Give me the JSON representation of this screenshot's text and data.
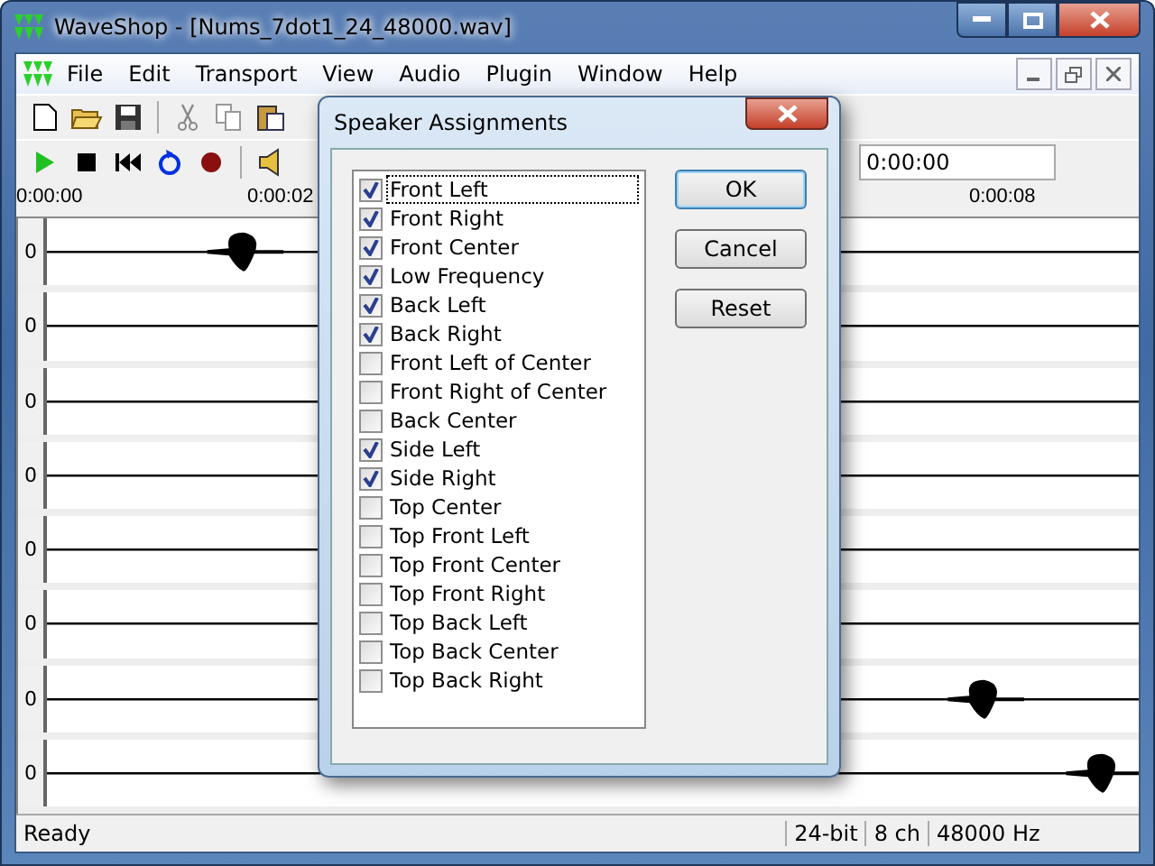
{
  "window": {
    "title": "WaveShop - [Nums_7dot1_24_48000.wav]"
  },
  "menu": [
    "File",
    "Edit",
    "Transport",
    "View",
    "Audio",
    "Plugin",
    "Window",
    "Help"
  ],
  "toolbar": {
    "position": "0:00:00"
  },
  "ruler": [
    "0:00:00",
    "0:00:02",
    "0:00:08"
  ],
  "tracks": [
    {
      "label": "0"
    },
    {
      "label": "0"
    },
    {
      "label": "0"
    },
    {
      "label": "0"
    },
    {
      "label": "0"
    },
    {
      "label": "0"
    },
    {
      "label": "0"
    },
    {
      "label": "0"
    }
  ],
  "dialog": {
    "title": "Speaker Assignments",
    "speakers": [
      {
        "label": "Front Left",
        "checked": true,
        "selected": true
      },
      {
        "label": "Front Right",
        "checked": true,
        "selected": false
      },
      {
        "label": "Front Center",
        "checked": true,
        "selected": false
      },
      {
        "label": "Low Frequency",
        "checked": true,
        "selected": false
      },
      {
        "label": "Back Left",
        "checked": true,
        "selected": false
      },
      {
        "label": "Back Right",
        "checked": true,
        "selected": false
      },
      {
        "label": "Front Left of Center",
        "checked": false,
        "selected": false
      },
      {
        "label": "Front Right of Center",
        "checked": false,
        "selected": false
      },
      {
        "label": "Back Center",
        "checked": false,
        "selected": false
      },
      {
        "label": "Side Left",
        "checked": true,
        "selected": false
      },
      {
        "label": "Side Right",
        "checked": true,
        "selected": false
      },
      {
        "label": "Top Center",
        "checked": false,
        "selected": false
      },
      {
        "label": "Top Front Left",
        "checked": false,
        "selected": false
      },
      {
        "label": "Top Front Center",
        "checked": false,
        "selected": false
      },
      {
        "label": "Top Front Right",
        "checked": false,
        "selected": false
      },
      {
        "label": "Top Back Left",
        "checked": false,
        "selected": false
      },
      {
        "label": "Top Back Center",
        "checked": false,
        "selected": false
      },
      {
        "label": "Top Back Right",
        "checked": false,
        "selected": false
      }
    ],
    "buttons": [
      "OK",
      "Cancel",
      "Reset"
    ]
  },
  "status_bar": [
    "Ready",
    "24-bit",
    "8 ch",
    "48000 Hz"
  ]
}
